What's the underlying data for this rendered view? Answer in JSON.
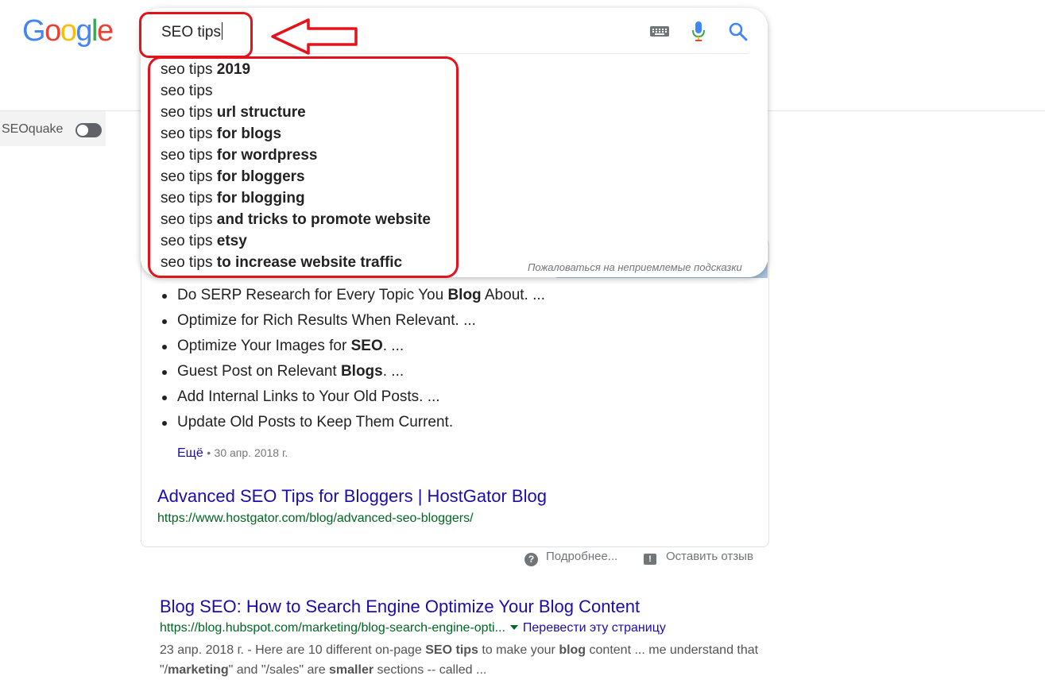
{
  "logo": {
    "letters": [
      "G",
      "o",
      "o",
      "g",
      "l",
      "e"
    ],
    "colors": [
      "#4285F4",
      "#EA4335",
      "#FBBC05",
      "#4285F4",
      "#34A853",
      "#EA4335"
    ]
  },
  "search": {
    "query": "SEO tips"
  },
  "suggestions": [
    {
      "prefix": "seo tips",
      "bold": "2019"
    },
    {
      "prefix": "seo tips",
      "bold": ""
    },
    {
      "prefix": "seo tips",
      "bold": "url structure"
    },
    {
      "prefix": "seo tips",
      "bold": "for blogs"
    },
    {
      "prefix": "seo tips",
      "bold": "for wordpress"
    },
    {
      "prefix": "seo tips",
      "bold": "for bloggers"
    },
    {
      "prefix": "seo tips",
      "bold": "for blogging"
    },
    {
      "prefix": "seo tips",
      "bold": "and tricks to promote website"
    },
    {
      "prefix": "seo tips",
      "bold": "etsy"
    },
    {
      "prefix": "seo tips",
      "bold": "to increase website traffic"
    }
  ],
  "report_suggestions": "Пожаловаться на неприемлемые подсказки",
  "sidebar": {
    "seoquake_label": "SEOquake"
  },
  "featured": {
    "bullets": [
      [
        "Do SERP Research for Every Topic You ",
        "Blog",
        " About. ..."
      ],
      [
        "Optimize for Rich Results When Relevant. ...",
        "",
        ""
      ],
      [
        "Optimize Your Images for ",
        "SEO",
        ". ..."
      ],
      [
        "Guest Post on Relevant ",
        "Blogs",
        ". ..."
      ],
      [
        "Add Internal Links to Your Old Posts. ...",
        "",
        ""
      ],
      [
        "Update Old Posts to Keep Them Current.",
        "",
        ""
      ]
    ],
    "more_link": "Ещё",
    "separator": "•",
    "date": "30 апр. 2018 г.",
    "title": "Advanced SEO Tips for Bloggers | HostGator Blog",
    "url": "https://www.hostgator.com/blog/advanced-seo-bloggers/"
  },
  "feedback": {
    "about": "Подробнее...",
    "leave_feedback": "Оставить отзыв",
    "about_icon": "?",
    "feedback_icon": "!"
  },
  "result2": {
    "title": "Blog SEO: How to Search Engine Optimize Your Blog Content",
    "url": "https://blog.hubspot.com/marketing/blog-search-engine-opti...",
    "translate": "Перевести эту страницу",
    "snippet_parts": [
      [
        "23 апр. 2018 г. - Here are 10 different on-page ",
        false
      ],
      [
        "SEO tips",
        true
      ],
      [
        " to make your ",
        false
      ],
      [
        "blog",
        true
      ],
      [
        " content ... me understand that \"/",
        false
      ],
      [
        "marketing",
        true
      ],
      [
        "\" and \"/sales\" are ",
        false
      ],
      [
        "smaller",
        true
      ],
      [
        " sections -- called ...",
        false
      ]
    ]
  },
  "icons": {
    "keyboard": "keyboard-icon",
    "mic": "microphone-icon",
    "search": "search-icon"
  },
  "annotation_color": "#e3121b"
}
